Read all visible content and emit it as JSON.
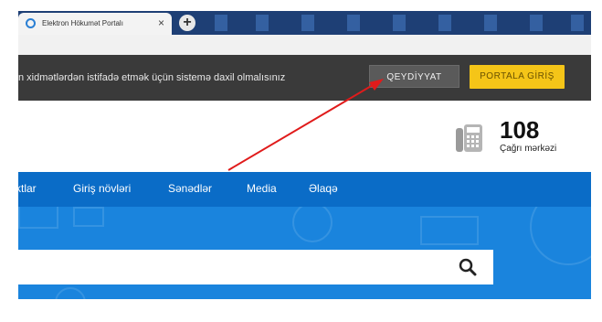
{
  "browser": {
    "tab_title": "Elektron Hökumət Portalı",
    "tab_close": "×",
    "new_tab": "+"
  },
  "loginbar": {
    "message": "n xidmətlərdən istifadə etmək üçün sistemə daxil olmalısınız",
    "register_label": "QEYDİYYAT",
    "login_label": "PORTALA GİRİŞ",
    "login_color": "#f5c518"
  },
  "header": {
    "call_number": "108",
    "call_label": "Çağrı mərkəzi"
  },
  "nav": {
    "items": [
      "ktlar",
      "Giriş növləri",
      "Sənədlər",
      "Media",
      "Əlaqə"
    ],
    "color": "#0a6cc7"
  },
  "icons": {
    "phone": "phone-icon",
    "search": "search-icon",
    "favicon": "favicon-icon"
  },
  "annotation": {
    "arrow_color": "#e01b1b"
  }
}
